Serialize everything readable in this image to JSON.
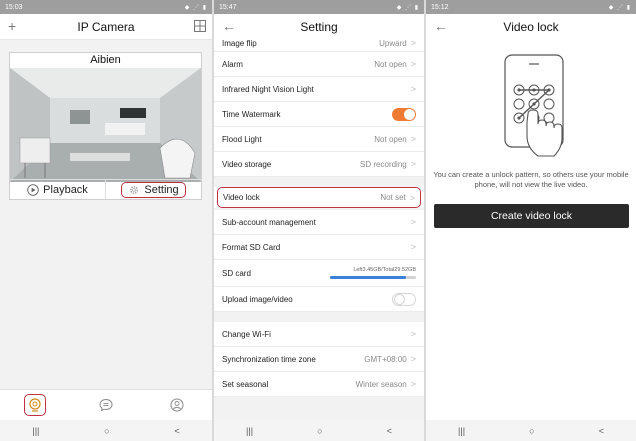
{
  "panel1": {
    "status_time": "15:03",
    "status_icons": "◆ ⋰ ▮",
    "title": "IP Camera",
    "camera_name": "Aibien",
    "playback_label": "Playback",
    "setting_label": "Setting",
    "nav_keys": [
      "|||",
      "○",
      "<"
    ]
  },
  "panel2": {
    "status_time": "15:47",
    "status_icons": "◆ ⋰ ▮",
    "title": "Setting",
    "rows": {
      "image_flip": {
        "label": "Image flip",
        "value": "Upward"
      },
      "alarm": {
        "label": "Alarm",
        "value": "Not open"
      },
      "infrared": {
        "label": "Infrared Night Vision Light",
        "value": ""
      },
      "watermark": {
        "label": "Time Watermark",
        "toggle": "on"
      },
      "flood": {
        "label": "Flood Light",
        "value": "Not open"
      },
      "storage": {
        "label": "Video storage",
        "value": "SD recording"
      },
      "video_lock": {
        "label": "Video lock",
        "value": "Not set"
      },
      "subaccount": {
        "label": "Sub-account management",
        "value": ""
      },
      "format_sd": {
        "label": "Format SD Card",
        "value": ""
      },
      "sd_card": {
        "label": "SD card",
        "value": "Left3.45GB/Total29.52GB",
        "used_fraction": 0.88
      },
      "upload": {
        "label": "Upload image/video",
        "toggle": "off"
      },
      "wifi": {
        "label": "Change Wi-Fi",
        "value": ""
      },
      "timezone": {
        "label": "Synchronization time zone",
        "value": "GMT+08:00"
      },
      "seasonal": {
        "label": "Set seasonal",
        "value": "Winter season"
      }
    },
    "nav_keys": [
      "|||",
      "○",
      "<"
    ]
  },
  "panel3": {
    "status_time": "15:12",
    "status_icons": "◆ ⋰ ▮",
    "title": "Video lock",
    "description": "You can create a unlock pattern, so others use your mobile phone, will not view the live video.",
    "button_label": "Create video lock",
    "nav_keys": [
      "|||",
      "○",
      "<"
    ]
  },
  "colors": {
    "highlight": "#c0323f",
    "toggle_on": "#f07a34",
    "sd_fill": "#3b7fd9",
    "button_dark": "#2a2a2a"
  }
}
